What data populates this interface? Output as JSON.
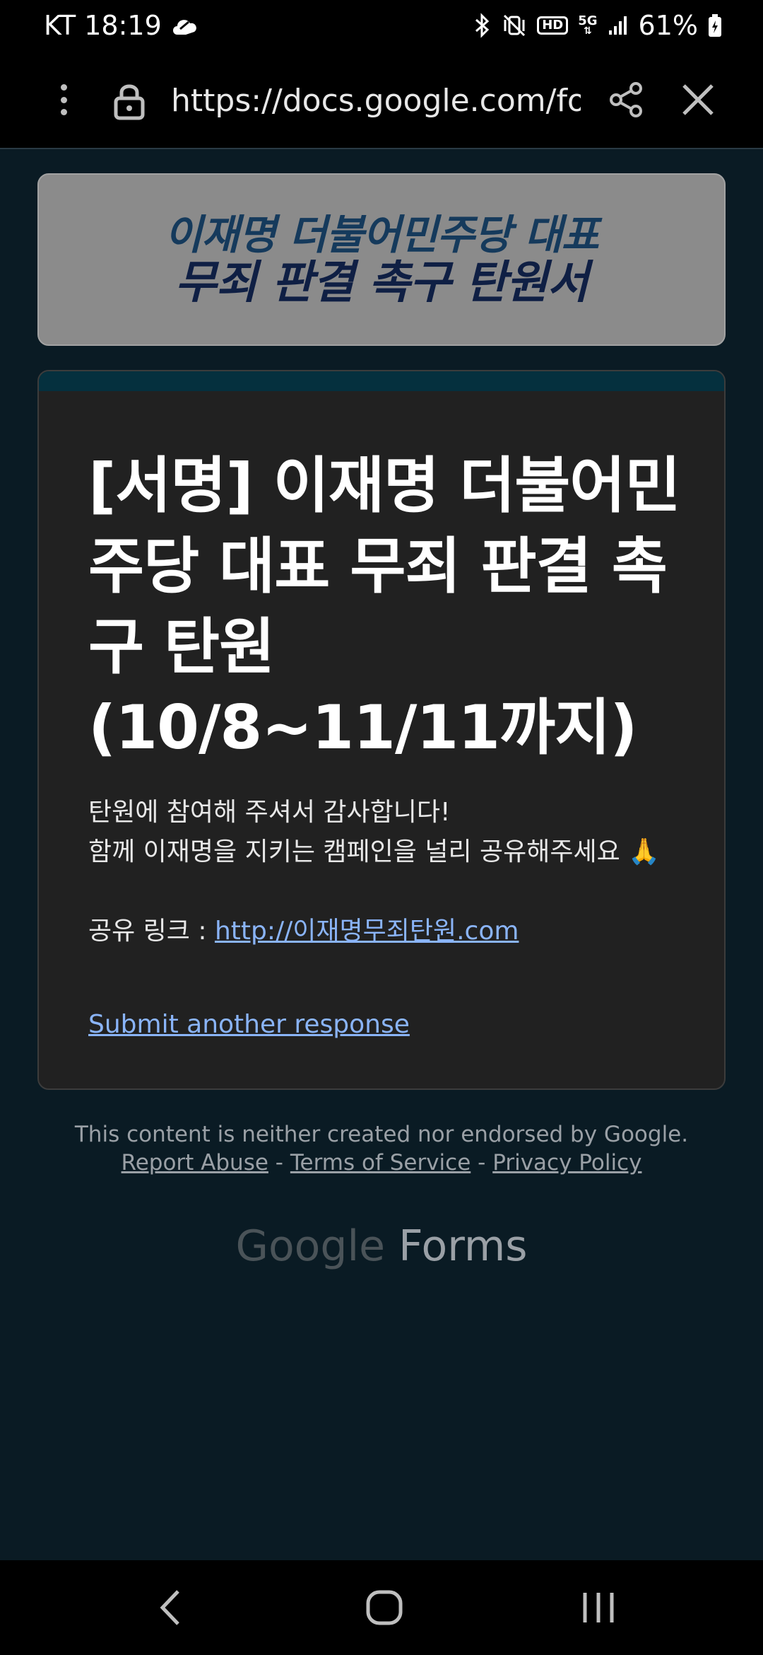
{
  "status_bar": {
    "carrier_time": "KT 18:19",
    "hd_label": "HD",
    "network_label": "5G",
    "battery_percent": "61%"
  },
  "browser": {
    "url": "https://docs.google.com/forms/"
  },
  "banner": {
    "line1": "이재명 더불어민주당 대표",
    "line2": "무죄 판결 촉구 탄원서"
  },
  "form": {
    "title": "[서명] 이재명 더불어민주당 대표 무죄 판결 촉구 탄원(10/8~11/11까지)",
    "thanks": "탄원에 참여해 주셔서 감사합니다!",
    "share_prompt": "함께 이재명을 지키는 캠페인을 널리 공유해주세요 🙏",
    "share_label": "공유 링크 : ",
    "share_link": "http://이재명무죄탄원.com",
    "submit_another": "Submit another response"
  },
  "footer": {
    "disclaimer": "This content is neither created nor endorsed by Google.",
    "report_abuse": "Report Abuse",
    "terms": "Terms of Service",
    "privacy": "Privacy Policy",
    "separator": " - ",
    "brand_google": "Google",
    "brand_forms": "Forms"
  }
}
